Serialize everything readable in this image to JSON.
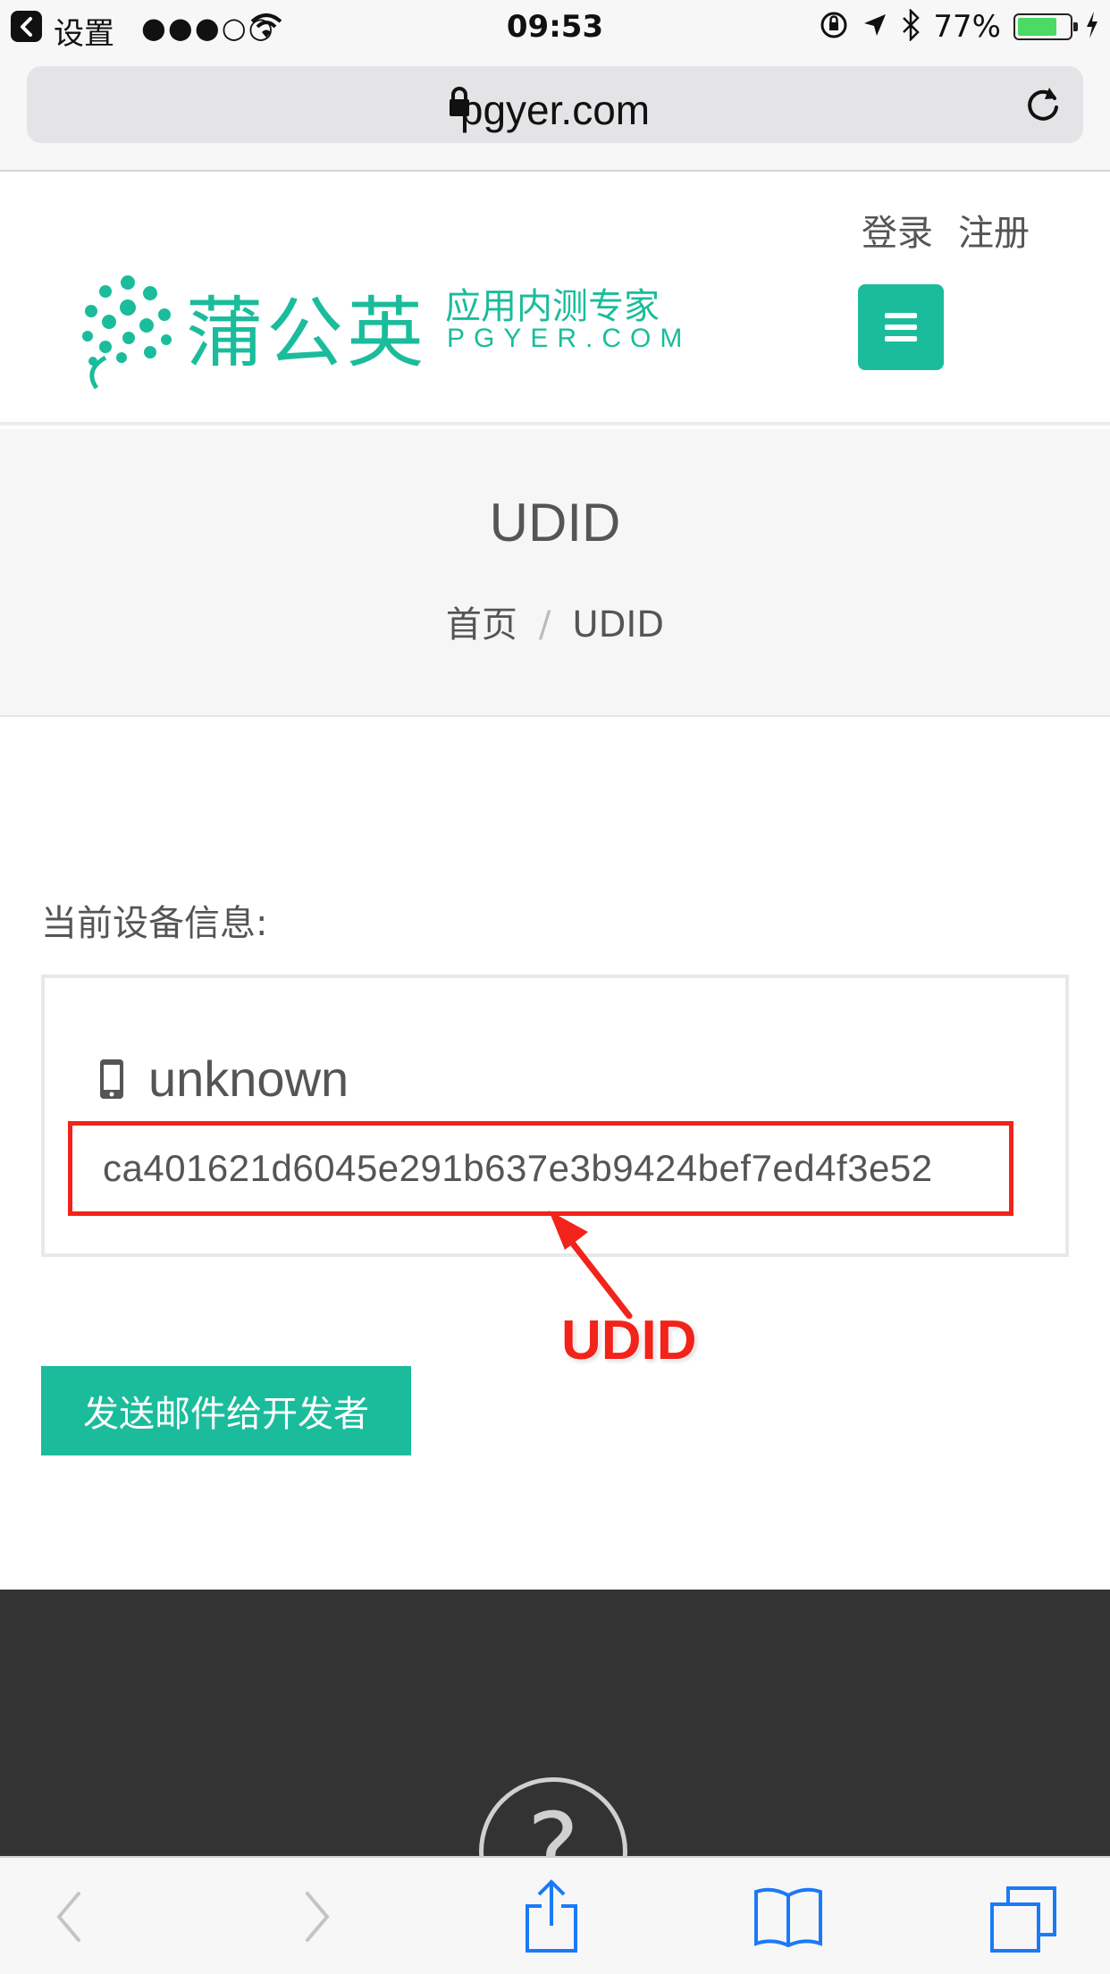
{
  "status_bar": {
    "back_label": "设置",
    "signal": "●●●○○",
    "time": "09:53",
    "battery_percent": "77%",
    "battery_level": 0.77
  },
  "address_bar": {
    "url": "pgyer.com"
  },
  "header": {
    "login_label": "登录",
    "register_label": "注册",
    "logo_name": "蒲公英",
    "logo_tagline": "应用内测专家",
    "logo_domain": "PGYER.COM",
    "accent_color": "#1bbc9b"
  },
  "title_band": {
    "title": "UDID",
    "breadcrumb": [
      "首页",
      "/",
      "UDID"
    ]
  },
  "device": {
    "section_label": "当前设备信息:",
    "name": "unknown",
    "udid": "ca401621d6045e291b637e3b9424bef7ed4f3e52"
  },
  "annotation": {
    "text": "UDID",
    "color": "#f2231b"
  },
  "send_button_label": "发送邮件给开发者",
  "footer": {
    "circle_glyph": "?"
  },
  "toolbar": {
    "icons": [
      "back-icon",
      "forward-icon",
      "share-icon",
      "bookmarks-icon",
      "tabs-icon"
    ]
  }
}
